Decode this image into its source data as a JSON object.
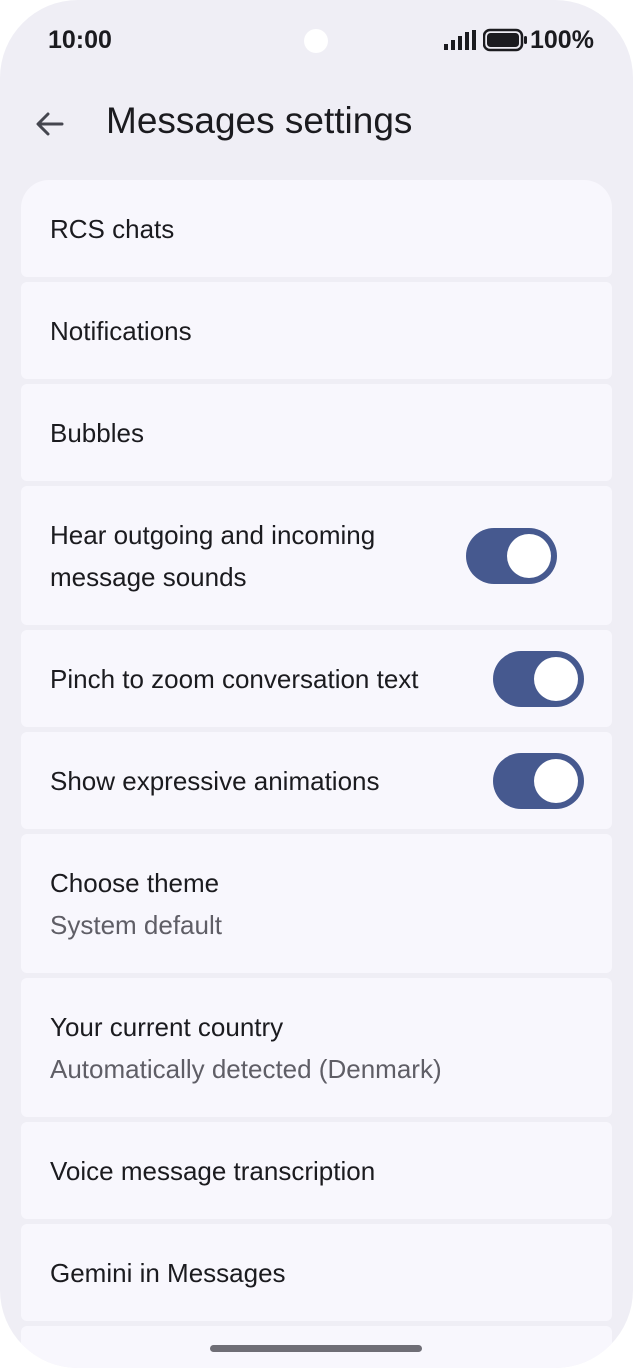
{
  "status_bar": {
    "time": "10:00",
    "battery": "100%",
    "icons": [
      "signal-icon",
      "battery-icon"
    ]
  },
  "app_bar": {
    "back_icon": "arrow-back-icon",
    "title": "Messages settings"
  },
  "settings": {
    "items": [
      {
        "label": "RCS chats"
      },
      {
        "label": "Notifications"
      },
      {
        "label": "Bubbles"
      },
      {
        "label": "Hear outgoing and incoming message sounds",
        "toggle_on": true
      },
      {
        "label": "Pinch to zoom conversation text",
        "toggle_on": true
      },
      {
        "label": "Show expressive animations",
        "toggle_on": true
      },
      {
        "label": "Choose theme",
        "sublabel": "System default"
      },
      {
        "label": "Your current country",
        "sublabel": "Automatically detected (Denmark)"
      },
      {
        "label": "Voice message transcription"
      },
      {
        "label": "Gemini in Messages"
      }
    ]
  },
  "colors": {
    "background": "#efeef5",
    "card": "#f8f7fd",
    "toggle_track": "#46598f",
    "text_primary": "#1b1b1f",
    "text_secondary": "#5f5e66"
  }
}
